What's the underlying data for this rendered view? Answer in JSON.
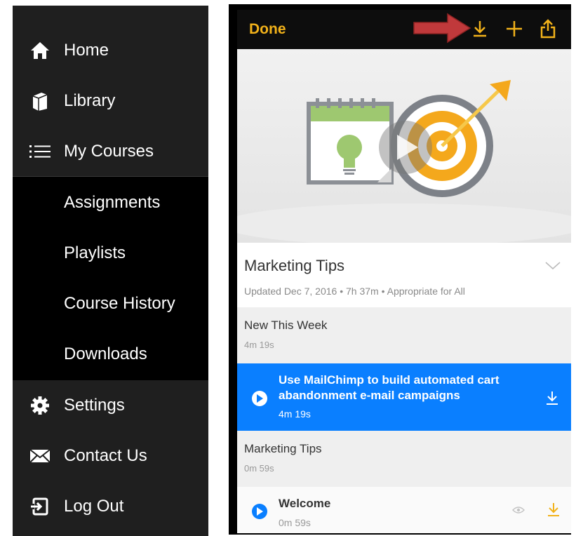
{
  "nav": {
    "items": [
      {
        "label": "Home",
        "icon": "home-icon"
      },
      {
        "label": "Library",
        "icon": "library-icon"
      },
      {
        "label": "My Courses",
        "icon": "list-icon"
      },
      {
        "label": "Assignments"
      },
      {
        "label": "Playlists"
      },
      {
        "label": "Course History"
      },
      {
        "label": "Downloads"
      },
      {
        "label": "Settings",
        "icon": "gear-icon"
      },
      {
        "label": "Contact Us",
        "icon": "envelope-icon"
      },
      {
        "label": "Log Out",
        "icon": "logout-icon"
      }
    ]
  },
  "toolbar": {
    "done_label": "Done",
    "icons": [
      "download-icon",
      "add-icon",
      "share-icon"
    ],
    "accent": "#f2b21a"
  },
  "course": {
    "title": "Marketing Tips",
    "meta": "Updated Dec 7, 2016 • 7h 37m • Appropriate for All"
  },
  "sections": [
    {
      "heading": "New This Week",
      "duration": "4m 19s",
      "lessons": [
        {
          "title": "Use MailChimp to build automated cart abandonment e-mail campaigns",
          "duration": "4m 19s",
          "highlighted": true
        }
      ]
    },
    {
      "heading": "Marketing Tips",
      "duration": "0m 59s",
      "lessons": [
        {
          "title": "Welcome",
          "duration": "0m 59s",
          "highlighted": false
        }
      ]
    }
  ],
  "colors": {
    "highlight": "#0a7fff",
    "nav_bg": "#1f1f1f",
    "accent": "#f2b21a"
  }
}
